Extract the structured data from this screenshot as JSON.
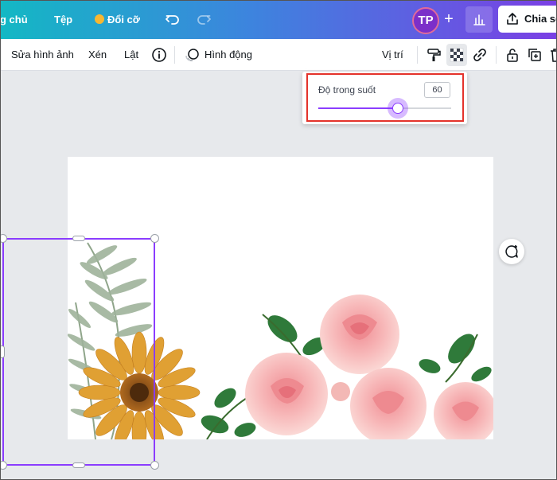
{
  "topbar": {
    "home_label": "g chủ",
    "file_label": "Tệp",
    "resize_label": "Đổi cỡ",
    "avatar_initials": "TP",
    "share_label": "Chia sẻ"
  },
  "toolbar": {
    "edit_image_label": "Sửa hình ảnh",
    "crop_label": "Xén",
    "flip_label": "Lật",
    "animate_label": "Hình động",
    "position_label": "Vị trí"
  },
  "transparency_popup": {
    "label": "Độ trong suốt",
    "value": "60",
    "slider_level": 0.6
  },
  "colors": {
    "accent": "#8b3dff",
    "highlight": "#e4322b"
  },
  "icons": [
    "undo-icon",
    "redo-icon",
    "info-icon",
    "animate-icon",
    "paint-roller-icon",
    "transparency-icon",
    "link-icon",
    "lock-icon",
    "add-page-icon",
    "trash-icon",
    "upload-icon",
    "stats-icon",
    "comment-add-icon",
    "crown-icon"
  ]
}
